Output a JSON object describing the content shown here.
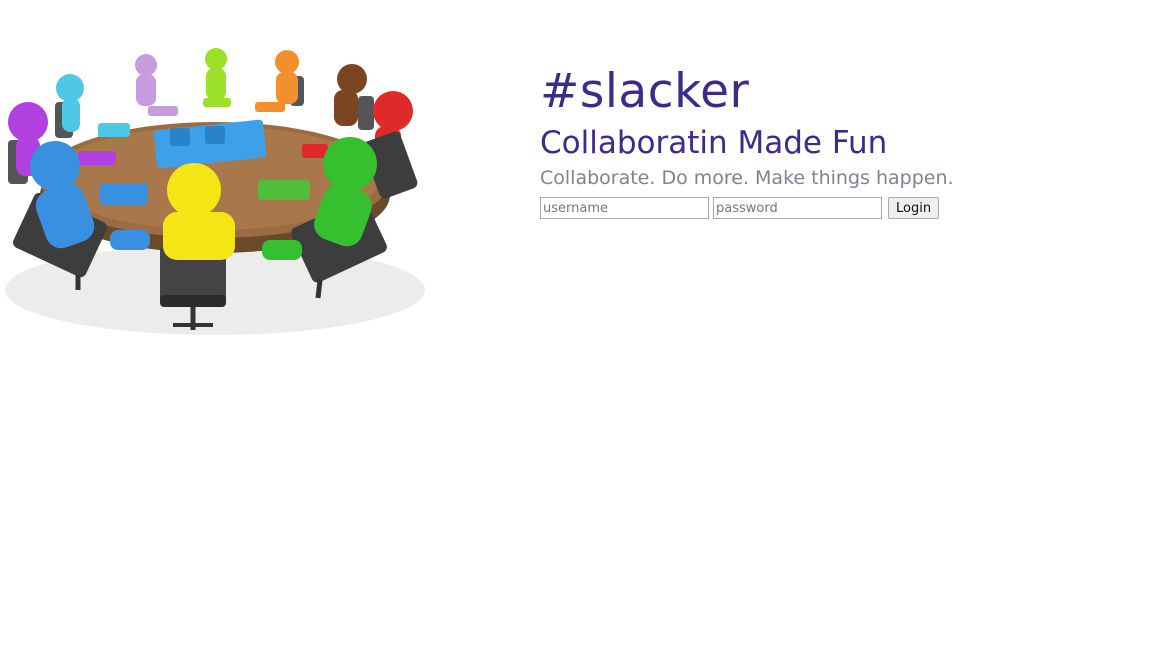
{
  "hero": {
    "image": "colleagues-around-table-puzzle-illustration"
  },
  "header": {
    "brand": "#slacker",
    "tagline": "Collaboratin Made Fun",
    "subline": "Collaborate. Do more. Make things happen."
  },
  "login": {
    "username_placeholder": "username",
    "password_placeholder": "password",
    "button_label": "Login"
  },
  "colors": {
    "brand": "#3d2a8a",
    "subline": "#7d8490"
  }
}
